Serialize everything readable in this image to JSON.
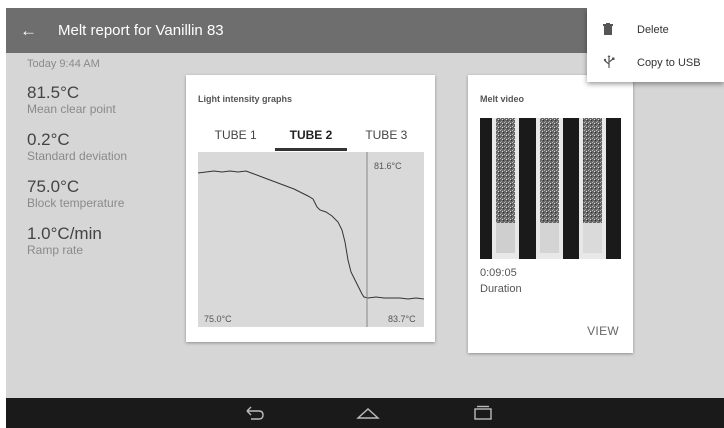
{
  "appbar": {
    "back_icon": "arrow-back-icon",
    "title": "Melt report for Vanillin 83"
  },
  "menu": {
    "items": [
      {
        "icon": "trash-icon",
        "label": "Delete"
      },
      {
        "icon": "usb-icon",
        "label": "Copy to USB"
      }
    ]
  },
  "stats": {
    "timestamp": "Today 9:44 AM",
    "items": [
      {
        "value": "81.5°C",
        "label": "Mean clear point"
      },
      {
        "value": "0.2°C",
        "label": "Standard deviation"
      },
      {
        "value": "75.0°C",
        "label": "Block temperature"
      },
      {
        "value": "1.0°C/min",
        "label": "Ramp rate"
      }
    ]
  },
  "graph_card": {
    "title": "Light intensity graphs",
    "tabs": [
      "TUBE 1",
      "TUBE 2",
      "TUBE 3"
    ],
    "active_tab": "TUBE 2",
    "start_temp": "75.0°C",
    "end_temp": "83.7°C",
    "marker_temp": "81.6°C"
  },
  "video_card": {
    "title": "Melt video",
    "duration_value": "0:09:05",
    "duration_label": "Duration",
    "view_label": "VIEW"
  },
  "navbar": {
    "icons": [
      "back-nav-icon",
      "home-nav-icon",
      "recents-nav-icon"
    ]
  },
  "colors": {
    "appbar": "#6e6e6e",
    "background": "#d6d6d6",
    "navbar": "#1a1a1a"
  }
}
